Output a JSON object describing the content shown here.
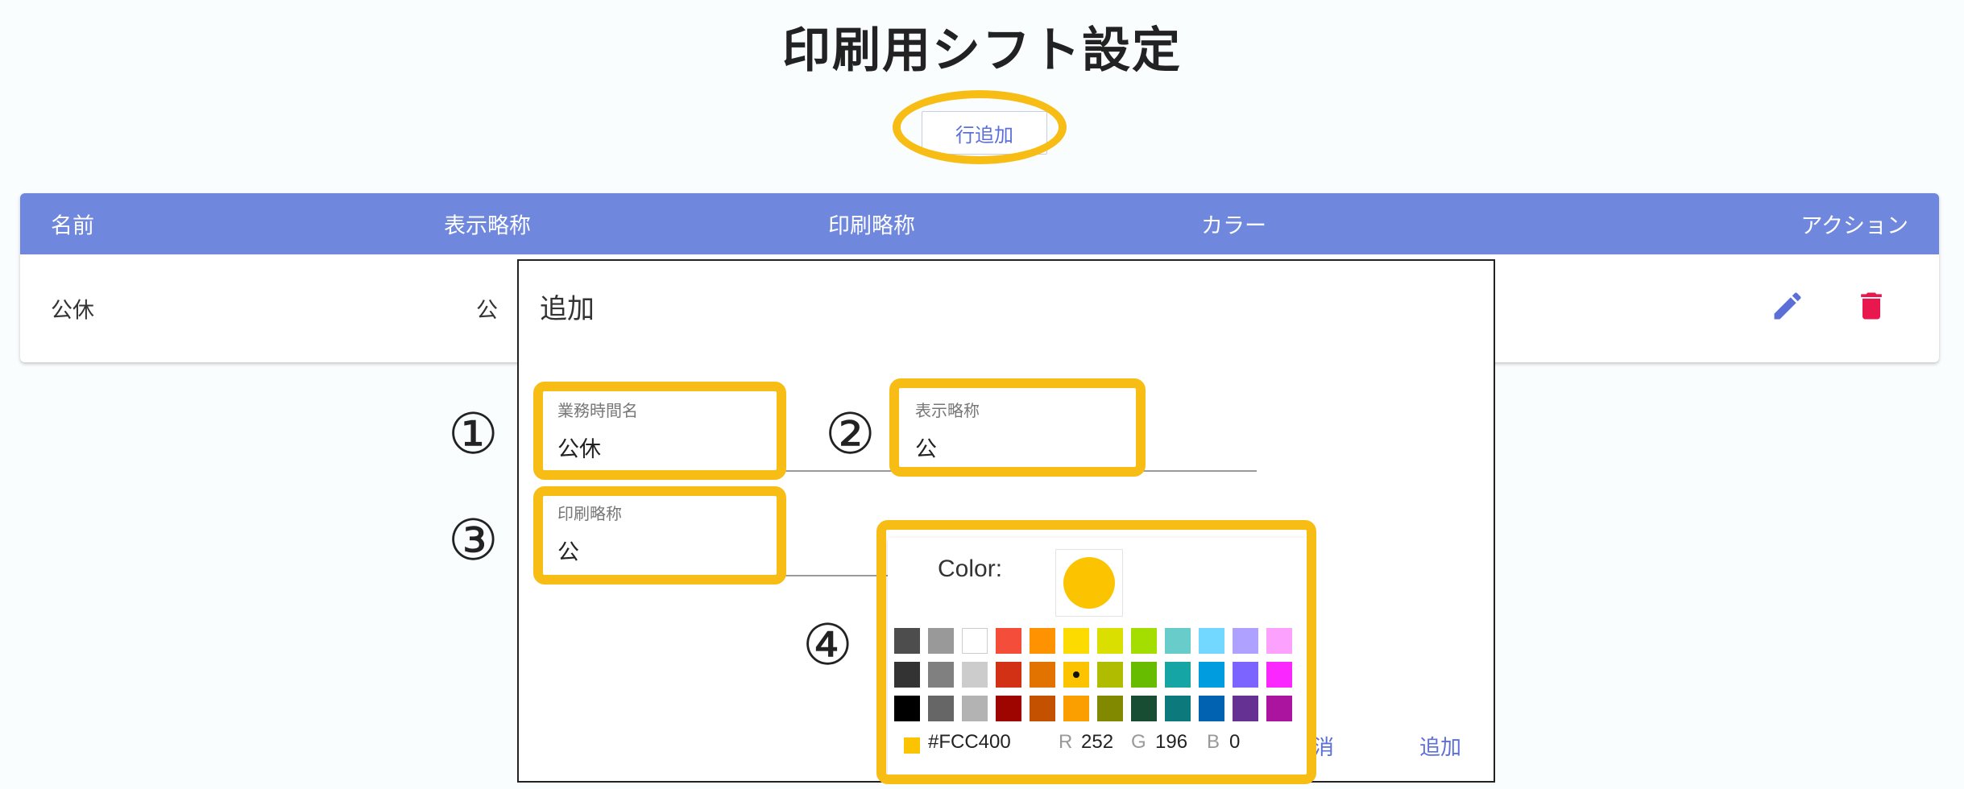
{
  "page": {
    "title": "印刷用シフト設定"
  },
  "toolbar": {
    "add_row_label": "行追加"
  },
  "table": {
    "headers": [
      "名前",
      "表示略称",
      "印刷略称",
      "カラー",
      "アクション"
    ],
    "rows": [
      {
        "name": "公休",
        "display_abbr": "公"
      }
    ],
    "icons": {
      "edit": "pencil-icon",
      "delete": "trash-icon"
    }
  },
  "dialog": {
    "title": "追加",
    "fields": {
      "name": {
        "label": "業務時間名",
        "value": "公休"
      },
      "display_abbr": {
        "label": "表示略称",
        "value": "公"
      },
      "print_abbr": {
        "label": "印刷略称",
        "value": "公"
      }
    },
    "cancel_label": "取消",
    "cancel_partial": "取消",
    "add_label": "追加"
  },
  "picker": {
    "label": "Color:",
    "selected_color": "#FCC400",
    "hex": "#FCC400",
    "r_label": "R",
    "r": "252",
    "g_label": "G",
    "g": "196",
    "b_label": "B",
    "b": "0",
    "swatches": [
      [
        "#4d4d4d",
        "#999999",
        "#ffffff",
        "#f44e3b",
        "#fe9200",
        "#fcdc00",
        "#dbdf00",
        "#a4dd00",
        "#68ccca",
        "#73d8ff",
        "#aea1ff",
        "#fda1ff"
      ],
      [
        "#333333",
        "#808080",
        "#cccccc",
        "#d33115",
        "#e27300",
        "#fcc400",
        "#b0bc00",
        "#68bc00",
        "#16a5a5",
        "#009ce0",
        "#7b64ff",
        "#fa28ff"
      ],
      [
        "#000000",
        "#666666",
        "#b3b3b3",
        "#9f0500",
        "#c45100",
        "#fb9e00",
        "#808900",
        "#194d33",
        "#0c797d",
        "#0062b1",
        "#653294",
        "#ab149e"
      ]
    ],
    "selected_index": [
      1,
      5
    ]
  },
  "annotations": {
    "n1": "①",
    "n2": "②",
    "n3": "③",
    "n4": "④",
    "highlight_color": "#f8bd15"
  },
  "colors": {
    "header": "#6f87dc",
    "accent": "#5c6fd6",
    "delete": "#e8184f"
  }
}
